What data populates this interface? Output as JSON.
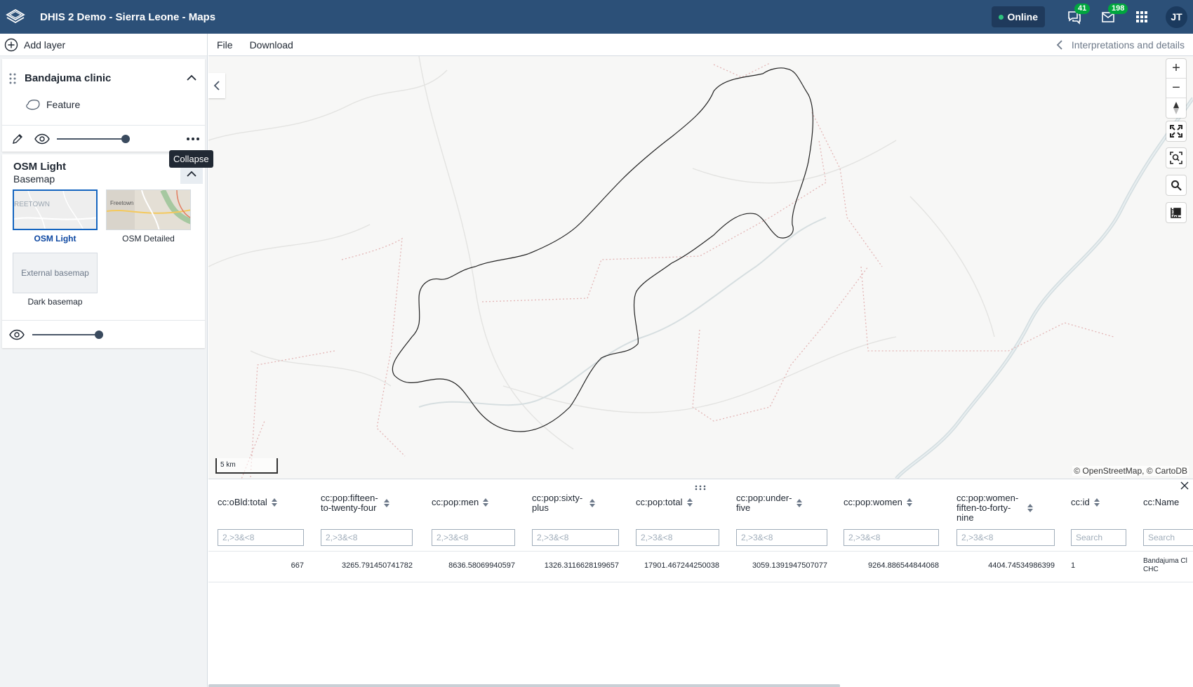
{
  "header": {
    "app_title": "DHIS 2 Demo - Sierra Leone - Maps",
    "status": "Online",
    "interpretations_count": "41",
    "messages_count": "198",
    "avatar_initials": "JT"
  },
  "left_panel": {
    "add_layer_label": "Add layer",
    "layer": {
      "name": "Bandajuma clinic",
      "legend_label": "Feature"
    },
    "tooltip": "Collapse",
    "basemap": {
      "title": "OSM Light",
      "subtitle": "Basemap",
      "items": [
        {
          "label": "OSM Light",
          "thumb_text": "REETOWN"
        },
        {
          "label": "OSM Detailed",
          "thumb_text": "Freetown"
        },
        {
          "label": "Dark basemap",
          "thumb_text": "External basemap"
        }
      ]
    }
  },
  "menubar": {
    "file": "File",
    "download": "Download",
    "interpretations": "Interpretations and details"
  },
  "map": {
    "scale_label": "5 km",
    "attribution": "© OpenStreetMap, © CartoDB",
    "controls": [
      "zoom-in",
      "zoom-out",
      "reset-bearing",
      "fullscreen",
      "zoom-to-content",
      "search",
      "measure"
    ]
  },
  "table": {
    "columns": [
      {
        "label": "cc:oBld:total",
        "filter": "2,>3&<8"
      },
      {
        "label": "cc:pop:fifteen-to-twenty-four",
        "filter": "2,>3&<8"
      },
      {
        "label": "cc:pop:men",
        "filter": "2,>3&<8"
      },
      {
        "label": "cc:pop:sixty-plus",
        "filter": "2,>3&<8"
      },
      {
        "label": "cc:pop:total",
        "filter": "2,>3&<8"
      },
      {
        "label": "cc:pop:under-five",
        "filter": "2,>3&<8"
      },
      {
        "label": "cc:pop:women",
        "filter": "2,>3&<8"
      },
      {
        "label": "cc:pop:women-fiften-to-forty-nine",
        "filter": "2,>3&<8"
      },
      {
        "label": "cc:id",
        "filter": "Search"
      },
      {
        "label": "cc:Name",
        "filter": "Search"
      }
    ],
    "row": [
      "667",
      "3265.791450741782",
      "8636.58069940597",
      "1326.3116628199657",
      "17901.467244250038",
      "3059.1391947507077",
      "9264.886544844068",
      "4404.74534986399",
      "1",
      "Bandajuma Cl CHC"
    ]
  }
}
